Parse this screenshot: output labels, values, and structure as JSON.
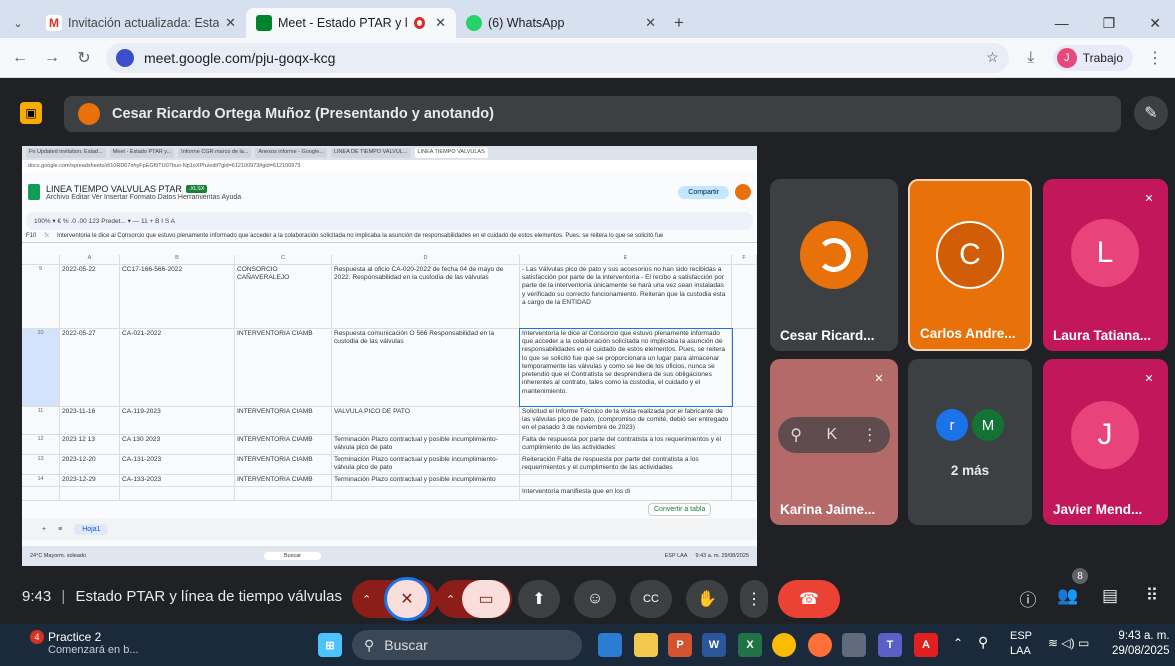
{
  "browser": {
    "tabs": [
      {
        "label": "Invitación actualizada: Estado P"
      },
      {
        "label": "Meet - Estado PTAR y línea"
      },
      {
        "label": "(6) WhatsApp"
      }
    ],
    "url": "meet.google.com/pju-goqx-kcg",
    "profile_label": "Trabajo",
    "profile_initial": "J"
  },
  "meet": {
    "presenter_label": "Cesar Ricardo Ortega Muñoz (Presentando y anotando)",
    "time": "9:43",
    "meeting_title": "Estado PTAR y línea de tiempo válvulas",
    "people_count": "8",
    "participants": [
      {
        "name": "Cesar Ricard...",
        "avatar": ""
      },
      {
        "name": "Carlos Andre...",
        "avatar": "C"
      },
      {
        "name": "Laura Tatiana...",
        "avatar": "L"
      },
      {
        "name": "Karina Jaime...",
        "avatar": ""
      },
      {
        "name": "2 más",
        "avatar_a": "r",
        "avatar_b": "M"
      },
      {
        "name": "Javier Mend...",
        "avatar": "J"
      }
    ]
  },
  "sheet": {
    "tabs": [
      "Fn Updated invitation: Estad...",
      "Meet - Estado PTAR y...",
      "Informe CGR marco de la...",
      "Anexos informe - Google...",
      "LINEA DE TIEMPO VALVUL...",
      "LINEA TIEMPO VALVULAS"
    ],
    "url": "docs.google.com/spreadsheets/d/10RD67ohyFpEGf9TU07buo-Np1oXPfu/edit?gid=612100973#gid=612100973",
    "title": "LINEA TIEMPO VALVULAS PTAR",
    "badge": ".XLSX",
    "menu": "Archivo  Editar  Ver  Insertar  Formato  Datos  Herramientas  Ayuda",
    "share": "Compartir",
    "toolbar": "100%  ▾  €  %  .0  .00  123  Predet...  ▾  —  11  +  B  I  S  A",
    "cell_ref": "F10",
    "formula": "Interventoria le dice al Consorcio que estuvo plenamente informado que acceder a la colaboración solicitada no implicaba la asunción de responsabilidades en el cuidado de estos elementos. Pues, se reitera lo que se solicitó fue",
    "columns": [
      "A",
      "B",
      "C",
      "D",
      "E",
      "F"
    ],
    "rows": [
      {
        "n": "9",
        "date": "2022-05-22",
        "code": "CC17-166-566-2022",
        "entity": "CONSORCIO CAÑAVERALEJO",
        "desc": "Respuesta al oficio CA-020-2022 de fecha 04 de mayo de 2022. Responsabilidad en la custodia de las válvulas",
        "obs": "- Las Válvulas pico de pato y sus accesorios no han sido recibidas a satisfacción por parte de la interventoría - El recibo a satisfacción por parte de la interventoría únicamente se hará una vez sean instaladas y verificado su correcto funcionamiento. Reiteran que la custodia esta a cargo de la ENTIDAD"
      },
      {
        "n": "10",
        "date": "2022-05-27",
        "code": "CA-021-2022",
        "entity": "INTERVENTORIA CIAMB",
        "desc": "Respuesta comunicación O 566 Responsabilidad en la custodia de las válvulas",
        "obs": "Interventoría le dice al Consorcio que estuvo plenamente informado que acceder a la colaboración solicitada no implicaba la asunción de responsabilidades en el cuidado de estos elementos. Pues, se reitera lo que se solicitó fue que se proporcionara un lugar para almacenar temporalmente las válvulas y como se lee de los oficios, nunca se pretendió que el Contratista se desprendiera de sus obligaciones inherentes al contrato, tales como la custodia, el cuidado y el mantenimiento."
      },
      {
        "n": "11",
        "date": "2023-11-16",
        "code": "CA-119-2023",
        "entity": "INTERVENTORIA CIAMB",
        "desc": "VALVULA PICO DE PATO",
        "obs": "Solicitud el Informe Técnico de la visita realizada por el fabricante de las válvulas pico de pato, (compromiso de comité, debió ser entregado en el pasado 3 de noviembre de 2023)"
      },
      {
        "n": "12",
        "date": "2023 12 13",
        "code": "CA 130 2023",
        "entity": "INTERVENTORIA CIAMB",
        "desc": "Terminación Plazo contractual y posible incumplimiento-válvula pico de pato",
        "obs": "Falta de respuesta por parte del contratista a los requerimientos y el cumplimiento de las actividades"
      },
      {
        "n": "13",
        "date": "2023-12-20",
        "code": "CA-131-2023",
        "entity": "INTERVENTORIA CIAMB",
        "desc": "Terminación Plazo contractual y posible incumplimiento-válvula pico de pato",
        "obs": "Reiteración Falta de respuesta por parte del contratista a los requerimientos y el cumplimiento de las actividades"
      },
      {
        "n": "14",
        "date": "2023-12-29",
        "code": "CA-133-2023",
        "entity": "INTERVENTORIA CIAMB",
        "desc": "Terminación Plazo contractual y posible incumplimiento",
        "obs": ""
      },
      {
        "n": "",
        "date": "",
        "code": "",
        "entity": "",
        "desc": "",
        "obs": "Interventoría manifiesta que en los di"
      }
    ],
    "sheet_tab": "Hoja1",
    "convert_label": "Convertir a tabla",
    "weather": "24°C Mayorm. soleado",
    "mini_search": "Buscar",
    "mini_clock": "9:43 a. m. 29/08/2025",
    "mini_lang": "ESP LAA"
  },
  "taskbar": {
    "notif_count": "4",
    "notif_title": "Practice 2",
    "notif_sub": "Comenzará en b...",
    "search": "Buscar",
    "lang": "ESP",
    "lang2": "LAA",
    "time": "9:43 a. m.",
    "date": "29/08/2025"
  }
}
